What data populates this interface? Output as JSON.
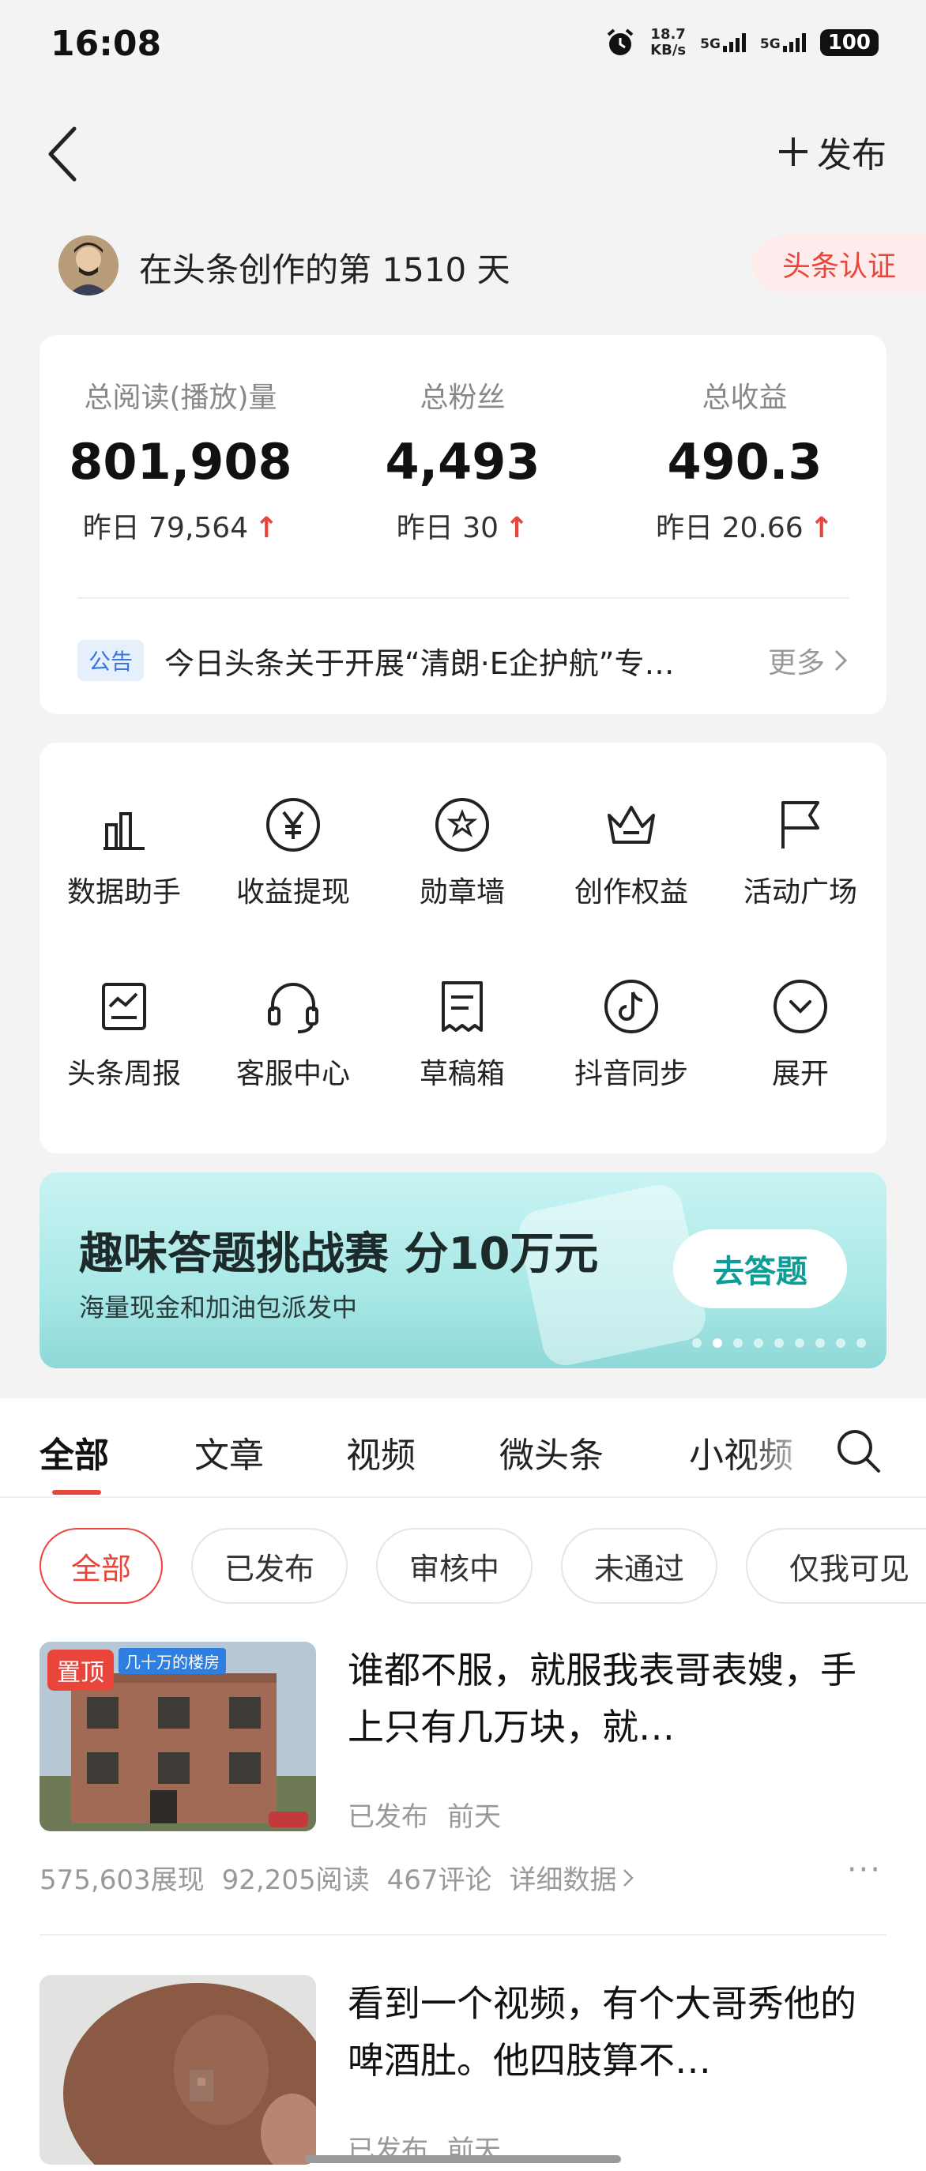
{
  "status_bar": {
    "time": "16:08",
    "net_speed_value": "18.7",
    "net_speed_unit": "KB/s",
    "sim1": "5G",
    "sim2": "5G",
    "battery": "100"
  },
  "header": {
    "publish_label": "发布"
  },
  "creator": {
    "days_text": "在头条创作的第 1510 天",
    "cert_label": "头条认证"
  },
  "stats": [
    {
      "label": "总阅读(播放)量",
      "value": "801,908",
      "delta": "昨日 79,564",
      "delta_arrow": "↑"
    },
    {
      "label": "总粉丝",
      "value": "4,493",
      "delta": "昨日 30",
      "delta_arrow": "↑"
    },
    {
      "label": "总收益",
      "value": "490.3",
      "delta": "昨日 20.66",
      "delta_arrow": "↑"
    }
  ],
  "notice": {
    "tag": "公告",
    "text": "今日头条关于开展“清朗·E企护航”专…",
    "more": "更多"
  },
  "tools": [
    {
      "label": "数据助手",
      "icon": "bar-chart-icon"
    },
    {
      "label": "收益提现",
      "icon": "yen-circle-icon"
    },
    {
      "label": "勋章墙",
      "icon": "medal-icon"
    },
    {
      "label": "创作权益",
      "icon": "crown-icon"
    },
    {
      "label": "活动广场",
      "icon": "flag-icon"
    },
    {
      "label": "头条周报",
      "icon": "report-icon"
    },
    {
      "label": "客服中心",
      "icon": "headset-icon"
    },
    {
      "label": "草稿箱",
      "icon": "draft-icon"
    },
    {
      "label": "抖音同步",
      "icon": "douyin-icon"
    },
    {
      "label": "展开",
      "icon": "chevron-down-circle-icon"
    }
  ],
  "banner": {
    "title": "趣味答题挑战赛 分10万元",
    "subtitle": "海量现金和加油包派发中",
    "button": "去答题",
    "accent": "#0c9e96"
  },
  "tabs": [
    "全部",
    "文章",
    "视频",
    "微头条",
    "小视频"
  ],
  "chips": [
    "全部",
    "已发布",
    "审核中",
    "未通过",
    "仅我可见"
  ],
  "items": [
    {
      "pinned": "置顶",
      "thumb_caption": "几十万的楼房",
      "title": "谁都不服，就服我表哥表嫂，手上只有几万块，就…",
      "status": "已发布",
      "time": "前天",
      "impressions": "575,603展现",
      "reads": "92,205阅读",
      "comments": "467评论",
      "details": "详细数据"
    },
    {
      "title": "看到一个视频，有个大哥秀他的啤酒肚。他四肢算不…",
      "status": "已发布",
      "time": "前天"
    }
  ],
  "colors": {
    "accent_red": "#e9453a",
    "notice_blue": "#3b76e0"
  }
}
